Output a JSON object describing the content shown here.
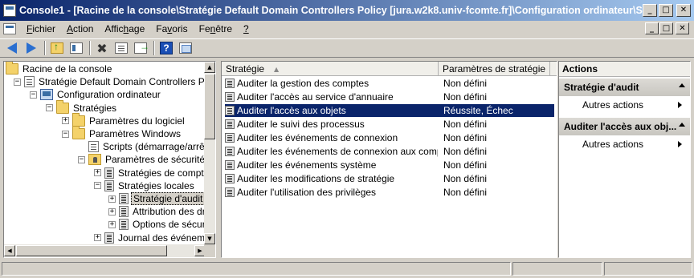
{
  "window": {
    "title": "Console1 - [Racine de la console\\Stratégie Default Domain Controllers Policy [jura.w2k8.univ-fcomte.fr]\\Configuration ordinateur\\Stratégie...",
    "minimize": "_",
    "maximize": "□",
    "close": "✕"
  },
  "menu": {
    "items": [
      "Fichier",
      "Action",
      "Affichage",
      "Favoris",
      "Fenêtre",
      "?"
    ],
    "accel": [
      "F",
      "A",
      "h",
      "v",
      "n",
      "?"
    ]
  },
  "tree": {
    "items": [
      {
        "label": "Racine de la console",
        "icon": "folder-icon",
        "expander": ""
      },
      {
        "label": "Stratégie Default Domain Controllers Policy",
        "icon": "policy-doc-icon",
        "expander": "−"
      },
      {
        "label": "Configuration ordinateur",
        "icon": "computer-icon",
        "expander": "−"
      },
      {
        "label": "Stratégies",
        "icon": "folder-icon",
        "expander": "−"
      },
      {
        "label": "Paramètres du logiciel",
        "icon": "folder-icon",
        "expander": "+"
      },
      {
        "label": "Paramètres Windows",
        "icon": "folder-icon",
        "expander": "−"
      },
      {
        "label": "Scripts (démarrage/arrêt)",
        "icon": "script-doc-icon",
        "expander": ""
      },
      {
        "label": "Paramètres de sécurité",
        "icon": "security-icon",
        "expander": "−"
      },
      {
        "label": "Stratégies de comptes",
        "icon": "policy-icon",
        "expander": "+"
      },
      {
        "label": "Stratégies locales",
        "icon": "policy-icon",
        "expander": "−"
      },
      {
        "label": "Stratégie d'audit",
        "icon": "policy-icon",
        "expander": "+"
      },
      {
        "label": "Attribution des dro",
        "icon": "policy-icon",
        "expander": "+"
      },
      {
        "label": "Options de sécurité",
        "icon": "policy-icon",
        "expander": "+"
      },
      {
        "label": "Journal des événement",
        "icon": "policy-icon",
        "expander": "+"
      }
    ]
  },
  "list": {
    "columns": [
      "Stratégie",
      "Paramètres de stratégie"
    ],
    "rows": [
      {
        "policy": "Auditer la gestion des comptes",
        "setting": "Non défini"
      },
      {
        "policy": "Auditer l'accès au service d'annuaire",
        "setting": "Non défini"
      },
      {
        "policy": "Auditer l'accès aux objets",
        "setting": "Réussite, Échec"
      },
      {
        "policy": "Auditer le suivi des processus",
        "setting": "Non défini"
      },
      {
        "policy": "Auditer les événements de connexion",
        "setting": "Non défini"
      },
      {
        "policy": "Auditer les événements de connexion aux comptes",
        "setting": "Non défini"
      },
      {
        "policy": "Auditer les événements système",
        "setting": "Non défini"
      },
      {
        "policy": "Auditer les modifications de stratégie",
        "setting": "Non défini"
      },
      {
        "policy": "Auditer l'utilisation des privilèges",
        "setting": "Non défini"
      }
    ]
  },
  "actions": {
    "title": "Actions",
    "sections": [
      {
        "header": "Stratégie d'audit",
        "item": "Autres actions"
      },
      {
        "header": "Auditer l'accès aux obj...",
        "item": "Autres actions"
      }
    ]
  },
  "colors": {
    "selection": "#0a246a",
    "titlebar_start": "#0a246a",
    "titlebar_end": "#a6caf0",
    "chrome": "#d4d0c8"
  }
}
